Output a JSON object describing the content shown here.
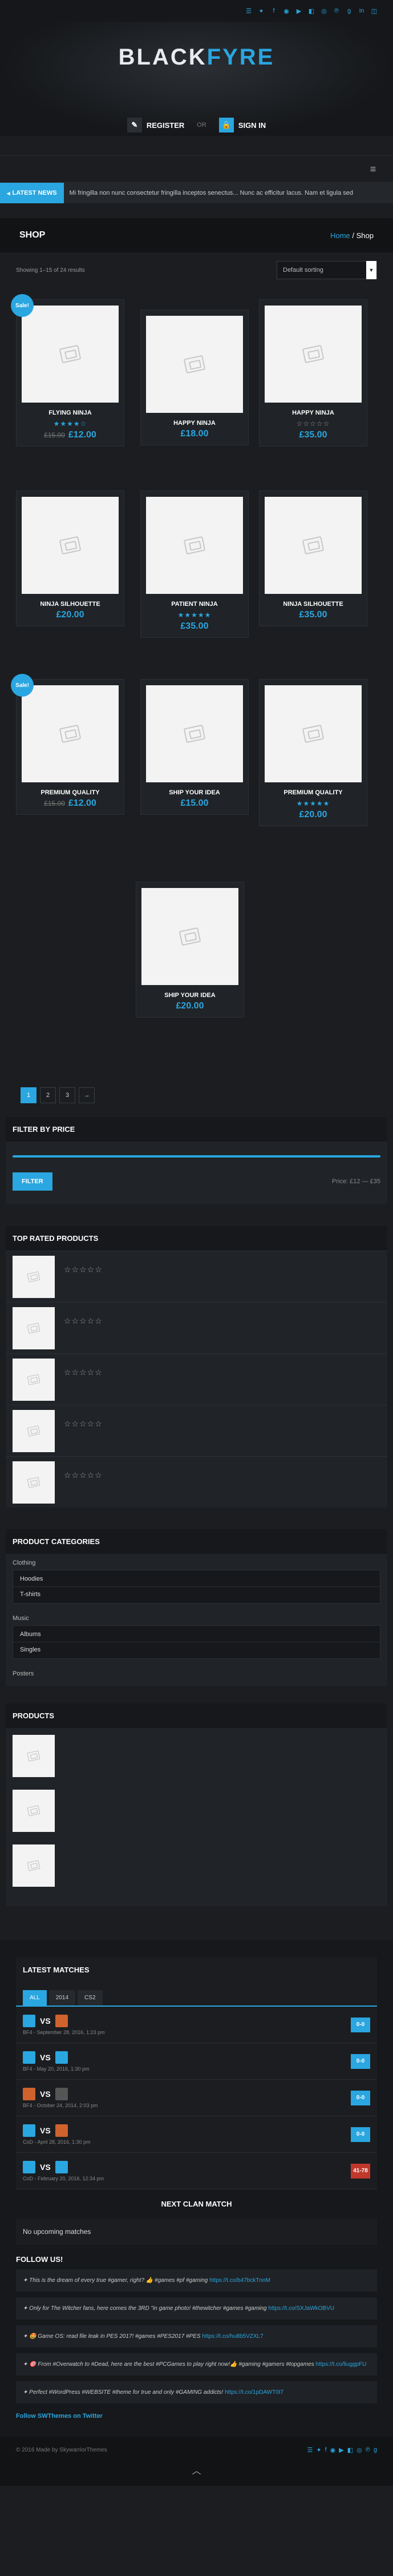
{
  "topbar": {
    "icons": [
      "rss-icon",
      "twitter-icon",
      "facebook-icon",
      "steam-icon",
      "youtube-icon",
      "twitch-icon",
      "dribbble-icon",
      "pinterest-icon",
      "google-plus-icon",
      "linkedin-icon",
      "instagram-icon"
    ]
  },
  "brand": {
    "logo_black": "BLACK",
    "logo_fyre": "FYRE"
  },
  "auth": {
    "register": "REGISTER",
    "or": "OR",
    "signin": "SIGN IN"
  },
  "ticker": {
    "label": "LATEST NEWS",
    "text": "Mi fringilla non nunc consectetur fringilla inceptos senectus...    Nunc ac efficitur lacus. Nam et ligula sed"
  },
  "page": {
    "title": "SHOP",
    "crumb_home": "Home",
    "crumb_sep": " / ",
    "crumb_current": "Shop"
  },
  "shop": {
    "showing": "Showing 1–15 of 24 results",
    "sort": "Default sorting",
    "sale_label": "Sale!",
    "products": [
      {
        "name": "FLYING NINJA",
        "stars": "★★★★☆",
        "old": "£15.00",
        "price": "£12.00",
        "sale": true
      },
      {
        "name": "HAPPY NINJA",
        "stars": "",
        "old": "",
        "price": "£18.00",
        "sale": false
      },
      {
        "name": "HAPPY NINJA",
        "stars": "☆☆☆☆☆",
        "old": "",
        "price": "£35.00",
        "sale": false
      },
      {
        "name": "NINJA SILHOUETTE",
        "stars": "",
        "old": "",
        "price": "£20.00",
        "sale": false
      },
      {
        "name": "PATIENT NINJA",
        "stars": "★★★★★",
        "old": "",
        "price": "£35.00",
        "sale": false
      },
      {
        "name": "NINJA SILHOUETTE",
        "stars": "",
        "old": "",
        "price": "£35.00",
        "sale": false
      },
      {
        "name": "PREMIUM QUALITY",
        "stars": "",
        "old": "£15.00",
        "price": "£12.00",
        "sale": true
      },
      {
        "name": "SHIP YOUR IDEA",
        "stars": "",
        "old": "",
        "price": "£15.00",
        "sale": false
      },
      {
        "name": "PREMIUM QUALITY",
        "stars": "★★★★★",
        "old": "",
        "price": "£20.00",
        "sale": false
      },
      {
        "name": "SHIP YOUR IDEA",
        "stars": "",
        "old": "",
        "price": "£20.00",
        "sale": false
      }
    ],
    "pages": [
      "1",
      "2",
      "3",
      "→"
    ]
  },
  "filter": {
    "title": "FILTER BY PRICE",
    "button": "FILTER",
    "range": "Price: £12 — £35"
  },
  "top_rated": {
    "title": "TOP RATED PRODUCTS",
    "stars": "☆☆☆☆☆"
  },
  "categories": {
    "title": "PRODUCT CATEGORIES",
    "groups": [
      {
        "label": "Clothing",
        "items": [
          "Hoodies",
          "T-shirts"
        ]
      },
      {
        "label": "Music",
        "items": [
          "Albums",
          "Singles"
        ]
      }
    ],
    "posters": "Posters"
  },
  "products_widget": {
    "title": "PRODUCTS"
  },
  "matches": {
    "title": "LATEST MATCHES",
    "tabs": [
      "ALL",
      "2014",
      "CS2"
    ],
    "vs": "VS",
    "items": [
      {
        "date": "BF4 - September 28, 2016, 1:23 pm",
        "score": "0-0",
        "lose": false
      },
      {
        "date": "BF4 - May 20, 2016, 1:30 pm",
        "score": "0-0",
        "lose": false
      },
      {
        "date": "BF4 - October 24, 2014, 2:03 pm",
        "score": "0-0",
        "lose": false
      },
      {
        "date": "CoD - April 28, 2016, 1:30 pm",
        "score": "0-0",
        "lose": false
      },
      {
        "date": "CoD - February 20, 2016, 12:34 pm",
        "score": "41-78",
        "lose": true
      }
    ],
    "next_title": "NEXT CLAN MATCH",
    "no_upcoming": "No upcoming matches"
  },
  "follow": {
    "title": "FOLLOW US!",
    "tweets": [
      {
        "text": "This is the dream of every true #gamer, right? 👍 #games #pf #gaming",
        "link": "https://t.co/b47bckTnnM"
      },
      {
        "text": "Only for The Witcher fans, here comes the 3RD \"in game photo! #thewitcher #games #gaming",
        "link": "https://t.co/SXJaWkOBVU"
      },
      {
        "text": "🤩 Game OS: read file leak in PES 2017! #games #PES2017 #PES",
        "link": "https://t.co/hu8b5VZXL7"
      },
      {
        "text": "🎯 From #Overwatch to #Dead, here are the best #PCGames to play right now!👍 #gaming #gamers #topgames",
        "link": "https://t.co/liuggpFU"
      },
      {
        "text": "Perfect #WordPress #WEBSITE #theme for true and only #GAMING addicts!",
        "link": "https://t.co/1pDAWT0I7"
      }
    ],
    "follow_link": "Follow SWThemes on Twitter"
  },
  "bottom": {
    "copyright": "© 2016 Made by SkywarriorThemes"
  },
  "accent": "#2aa6e0"
}
